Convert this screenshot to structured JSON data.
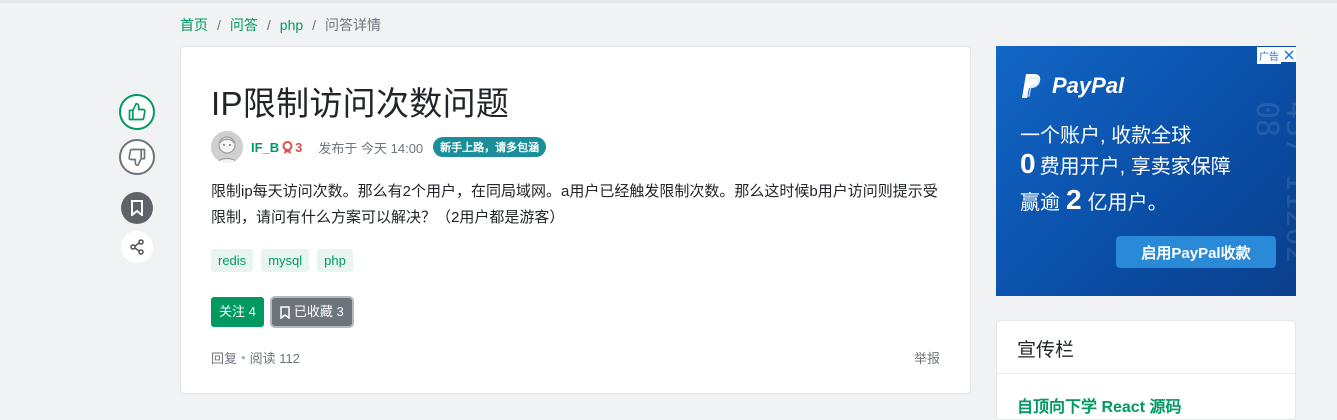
{
  "colors": {
    "brand": "#009a61",
    "page_bg": "#f1f2f3",
    "muted": "#6c757d",
    "ad_blue": "#0a4fa8"
  },
  "breadcrumb": {
    "items": [
      {
        "label": "首页"
      },
      {
        "label": "问答"
      },
      {
        "label": "php"
      }
    ],
    "separator": "/",
    "current": "问答详情"
  },
  "sidebar_actions": {
    "upvote_icon": "thumbs-up-icon",
    "downvote_icon": "thumbs-down-icon",
    "bookmark_icon": "bookmark-icon",
    "share_icon": "share-icon"
  },
  "question": {
    "title": "IP限制访问次数问题",
    "author": {
      "name": "IF_B",
      "reputation": "3",
      "avatar_icon": "avatar-icon",
      "medal_icon": "medal-icon"
    },
    "posted": "发布于 今天 14:00",
    "badge": "新手上路，请多包涵",
    "body": "限制ip每天访问次数。那么有2个用户，在同局域网。a用户已经触发限制次数。那么这时候b用户访问则提示受限制，请问有什么方案可以解决？（2用户都是游客）",
    "tags": [
      "redis",
      "mysql",
      "php"
    ],
    "follow_label": "关注 4",
    "favorite_label": "已收藏 3",
    "reply_label": "回复",
    "dot": "•",
    "views_label": "阅读 112",
    "report_label": "举报"
  },
  "ad": {
    "label": "广告",
    "brand": "PayPal",
    "line1": "一个账户, 收款全球",
    "line2_big": "0",
    "line2_rest": "费用开户, 享卖家保障",
    "line3_a": "赢逾",
    "line3_big": "2",
    "line3_b": "亿用户。",
    "cta": "启用PayPal收款",
    "pattern": "374529140 0 3834 2 16 3945 5437 1120208"
  },
  "promo": {
    "title": "宣传栏",
    "link": "自顶向下学 React 源码"
  }
}
